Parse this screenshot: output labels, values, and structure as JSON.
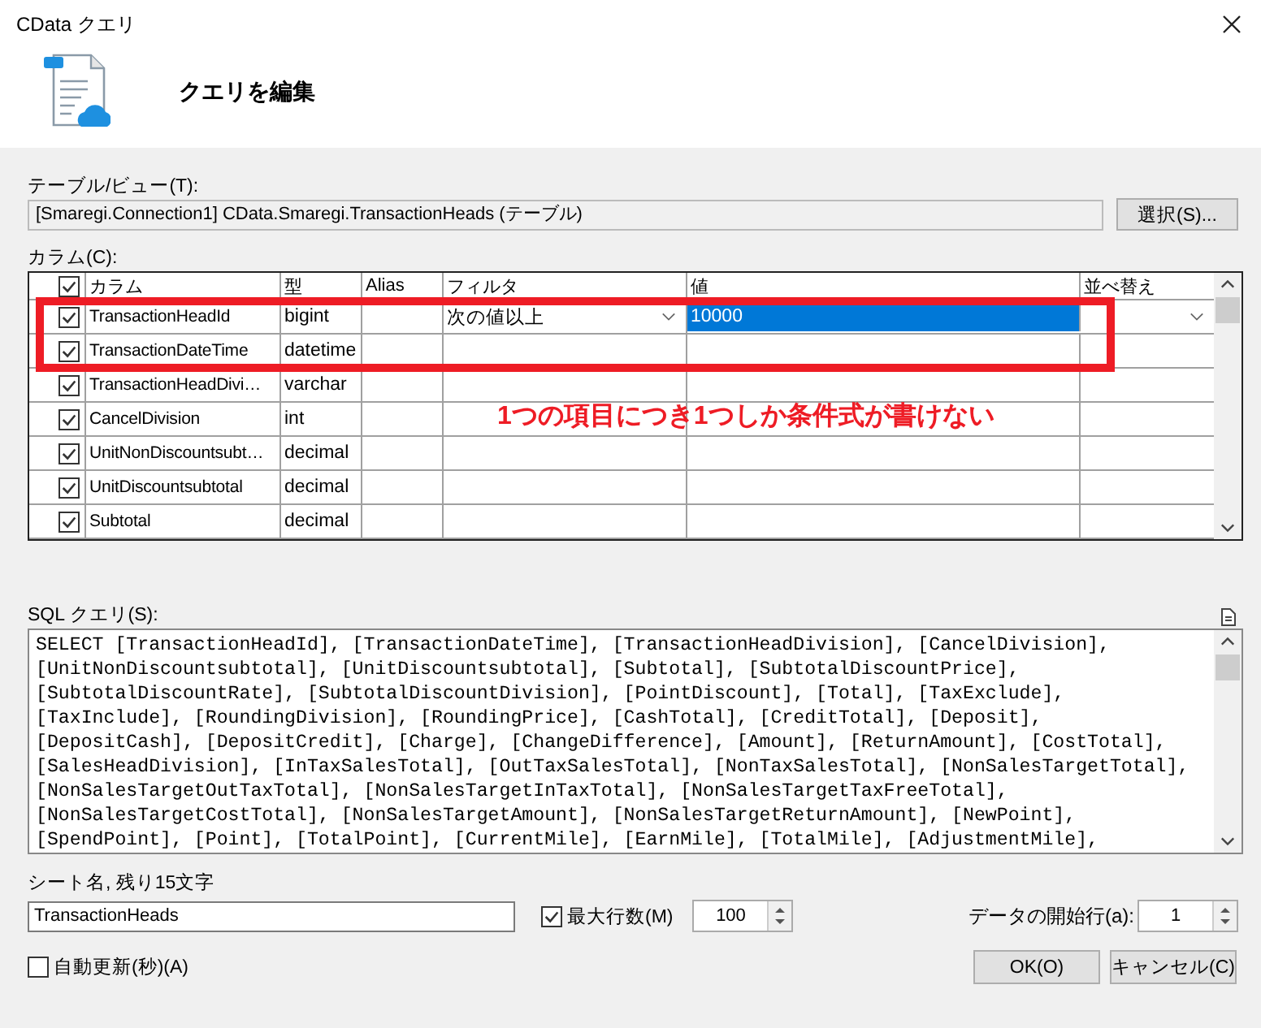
{
  "window": {
    "title": "CData クエリ"
  },
  "header": {
    "title": "クエリを編集"
  },
  "table_view": {
    "label": "テーブル/ビュー(T):",
    "value": "[Smaregi.Connection1] CData.Smaregi.TransactionHeads (テーブル)",
    "button": "選択(S)..."
  },
  "columns_grid": {
    "label": "カラム(C):",
    "all_checked": true,
    "headers": [
      "カラム",
      "型",
      "Alias",
      "フィルタ",
      "値",
      "並べ替え"
    ],
    "rows": [
      {
        "checked": true,
        "name": "TransactionHeadId",
        "type": "bigint",
        "filter": "次の値以上",
        "value": "10000",
        "selected": true
      },
      {
        "checked": true,
        "name": "TransactionDateTime",
        "type": "datetime",
        "selected": false
      },
      {
        "checked": true,
        "name": "TransactionHeadDivi…",
        "type": "varchar",
        "selected": false
      },
      {
        "checked": true,
        "name": "CancelDivision",
        "type": "int",
        "selected": false
      },
      {
        "checked": true,
        "name": "UnitNonDiscountsubt…",
        "type": "decimal",
        "selected": false
      },
      {
        "checked": true,
        "name": "UnitDiscountsubtotal",
        "type": "decimal",
        "selected": false
      },
      {
        "checked": true,
        "name": "Subtotal",
        "type": "decimal",
        "selected": false
      }
    ]
  },
  "annotation": {
    "text": "1つの項目につき1つしか条件式が書けない"
  },
  "sql": {
    "label": "SQL クエリ(S):",
    "lines": [
      "SELECT [TransactionHeadId], [TransactionDateTime], [TransactionHeadDivision], [CancelDivision],",
      "[UnitNonDiscountsubtotal], [UnitDiscountsubtotal], [Subtotal], [SubtotalDiscountPrice],",
      "[SubtotalDiscountRate], [SubtotalDiscountDivision], [PointDiscount], [Total], [TaxExclude],",
      "[TaxInclude], [RoundingDivision], [RoundingPrice], [CashTotal], [CreditTotal], [Deposit],",
      "[DepositCash], [DepositCredit], [Charge], [ChangeDifference], [Amount], [ReturnAmount], [CostTotal],",
      "[SalesHeadDivision], [InTaxSalesTotal], [OutTaxSalesTotal], [NonTaxSalesTotal], [NonSalesTargetTotal],",
      "[NonSalesTargetOutTaxTotal], [NonSalesTargetInTaxTotal], [NonSalesTargetTaxFreeTotal],",
      "[NonSalesTargetCostTotal], [NonSalesTargetAmount], [NonSalesTargetReturnAmount], [NewPoint],",
      "[SpendPoint], [Point], [TotalPoint], [CurrentMile], [EarnMile], [TotalMile], [AdjustmentMile],"
    ]
  },
  "sheet_name": {
    "label": "シート名, 残り15文字",
    "value": "TransactionHeads"
  },
  "max_rows": {
    "label": "最大行数(M)",
    "checked": true,
    "value": "100"
  },
  "start_row": {
    "label": "データの開始行(a):",
    "value": "1"
  },
  "auto_refresh": {
    "label": "自動更新(秒)(A)",
    "checked": false
  },
  "buttons": [
    "OK(O)",
    "キャンセル(C)"
  ]
}
